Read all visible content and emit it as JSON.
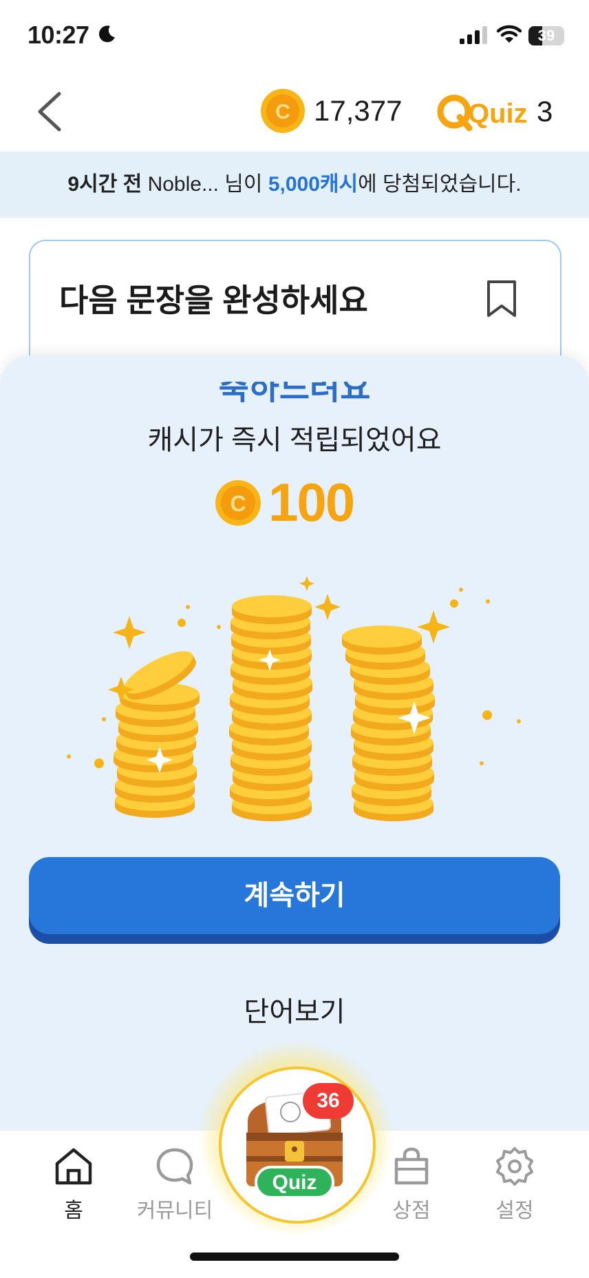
{
  "status": {
    "time": "10:27",
    "battery": "39",
    "battery_level": 0.39
  },
  "header": {
    "coin_balance": "17,377",
    "quiz_brand": "Quiz",
    "quiz_tickets": "3"
  },
  "ticker": {
    "time_ago": "9시간 전",
    "user": "Noble...",
    "mid": " 님이 ",
    "amount": "5,000캐시",
    "tail": "에 당첨되었습니다."
  },
  "quiz_card": {
    "title": "다음 문장을 완성하세요"
  },
  "reward_sheet": {
    "ghost_text": "축하드려요",
    "message": "캐시가 즉시 적립되었어요",
    "amount": "100",
    "continue_label": "계속하기",
    "view_words_label": "단어보기"
  },
  "tabbar": {
    "home": "홈",
    "community": "커뮤니티",
    "center_brand": "Quiz",
    "center_badge": "36",
    "shop": "상점",
    "settings": "설정"
  },
  "colors": {
    "accent_blue": "#2776d9",
    "coin_gold": "#f6a40f",
    "sheet_bg": "#e6f1fc",
    "badge_red": "#ef3b33"
  }
}
